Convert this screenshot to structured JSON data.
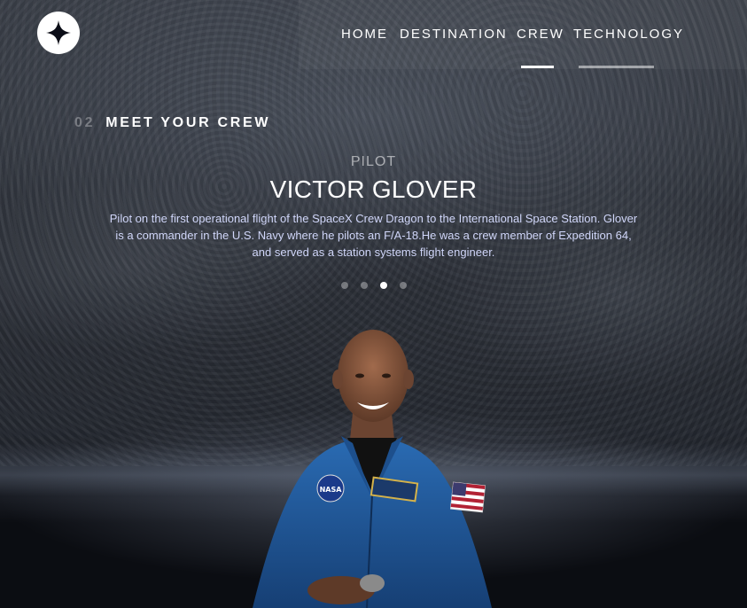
{
  "header": {
    "logo_icon": "star-icon",
    "nav": [
      {
        "label": "HOME"
      },
      {
        "label": "DESTINATION"
      },
      {
        "label": "CREW"
      },
      {
        "label": "TECHNOLOGY"
      }
    ],
    "active_nav": "CREW"
  },
  "main": {
    "heading_number": "02",
    "heading_text": "MEET YOUR CREW",
    "role": "PILOT",
    "name": "VICTOR GLOVER",
    "bio": "Pilot on the first operational flight of the SpaceX Crew Dragon to the International Space Station. Glover is a commander in the U.S. Navy where he pilots an F/A-18.He was a crew member of Expedition 64, and served as a station systems flight engineer.",
    "slider": {
      "count": 4,
      "active_index": 2
    }
  },
  "colors": {
    "text": "#ffffff",
    "bio_text": "#d0d6f9",
    "suit_blue": "#1f5a9e"
  }
}
